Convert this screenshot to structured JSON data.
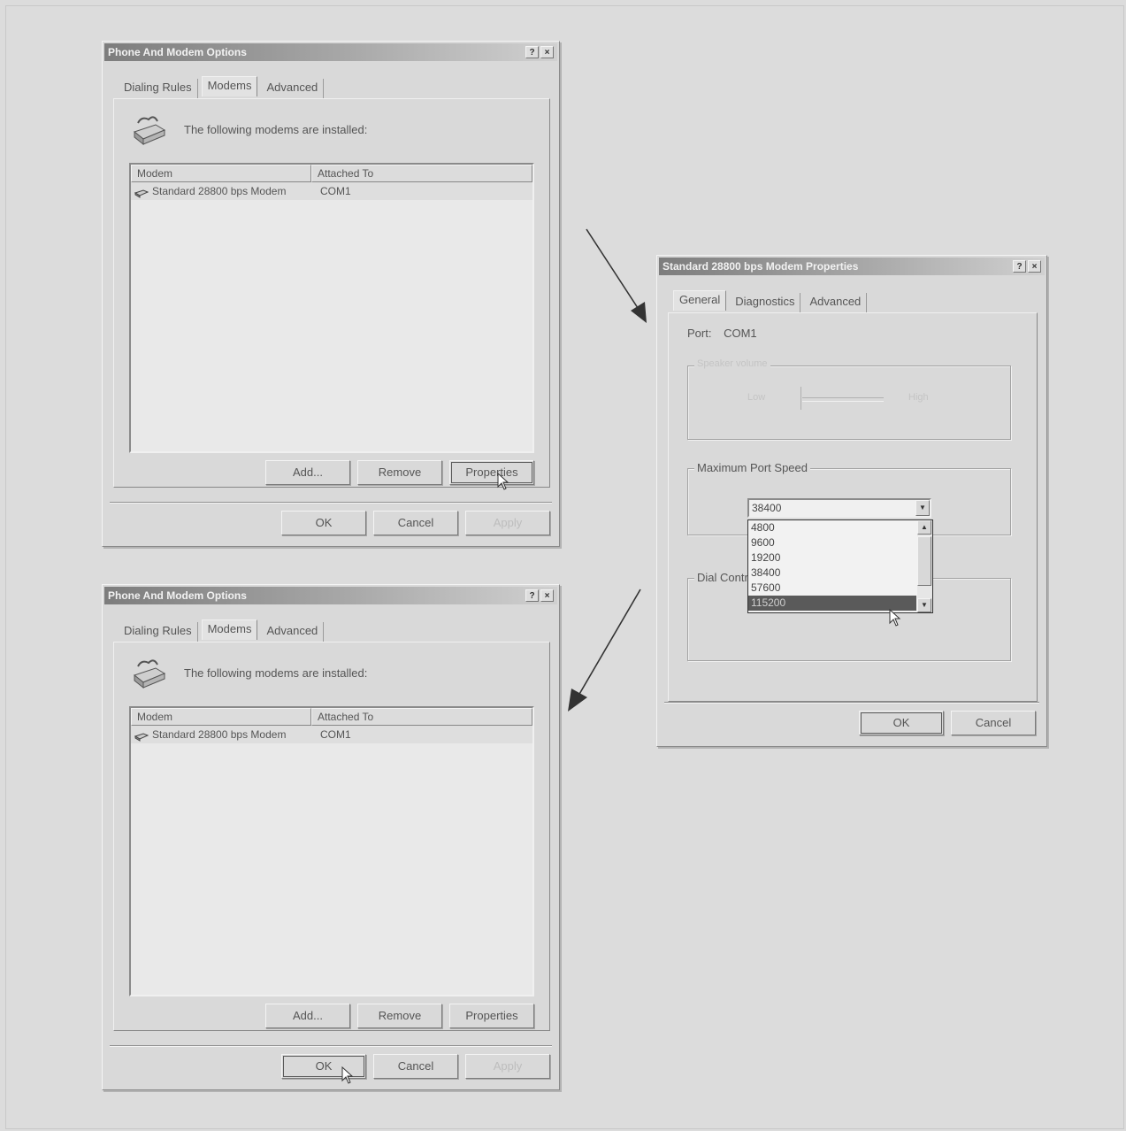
{
  "top_dialog": {
    "title": "Phone And Modem Options",
    "help_btn": "?",
    "close_btn": "×",
    "tabs": [
      "Dialing Rules",
      "Modems",
      "Advanced"
    ],
    "header_text": "The following modems are installed:",
    "columns": [
      "Modem",
      "Attached To"
    ],
    "rows": [
      {
        "modem": "Standard 28800 bps Modem",
        "port": "COM1"
      }
    ],
    "add_label": "Add...",
    "remove_label": "Remove",
    "properties_label": "Properties",
    "ok_label": "OK",
    "cancel_label": "Cancel",
    "apply_label": "Apply"
  },
  "bottom_dialog": {
    "title": "Phone And Modem Options",
    "help_btn": "?",
    "close_btn": "×",
    "tabs": [
      "Dialing Rules",
      "Modems",
      "Advanced"
    ],
    "header_text": "The following modems are installed:",
    "columns": [
      "Modem",
      "Attached To"
    ],
    "rows": [
      {
        "modem": "Standard 28800 bps Modem",
        "port": "COM1"
      }
    ],
    "add_label": "Add...",
    "remove_label": "Remove",
    "properties_label": "Properties",
    "ok_label": "OK",
    "cancel_label": "Cancel",
    "apply_label": "Apply"
  },
  "props_dialog": {
    "title": "Standard 28800 bps Modem Properties",
    "help_btn": "?",
    "close_btn": "×",
    "tabs": [
      "General",
      "Diagnostics",
      "Advanced"
    ],
    "port_label": "Port:",
    "port_value": "COM1",
    "speaker_group": "Speaker volume",
    "speaker_low": "Low",
    "speaker_high": "High",
    "max_speed_group": "Maximum Port Speed",
    "speed_selected": "38400",
    "speed_options": [
      "4800",
      "9600",
      "19200",
      "38400",
      "57600",
      "115200"
    ],
    "speed_highlighted": "115200",
    "dial_control_group": "Dial Control",
    "ok_label": "OK",
    "cancel_label": "Cancel"
  }
}
